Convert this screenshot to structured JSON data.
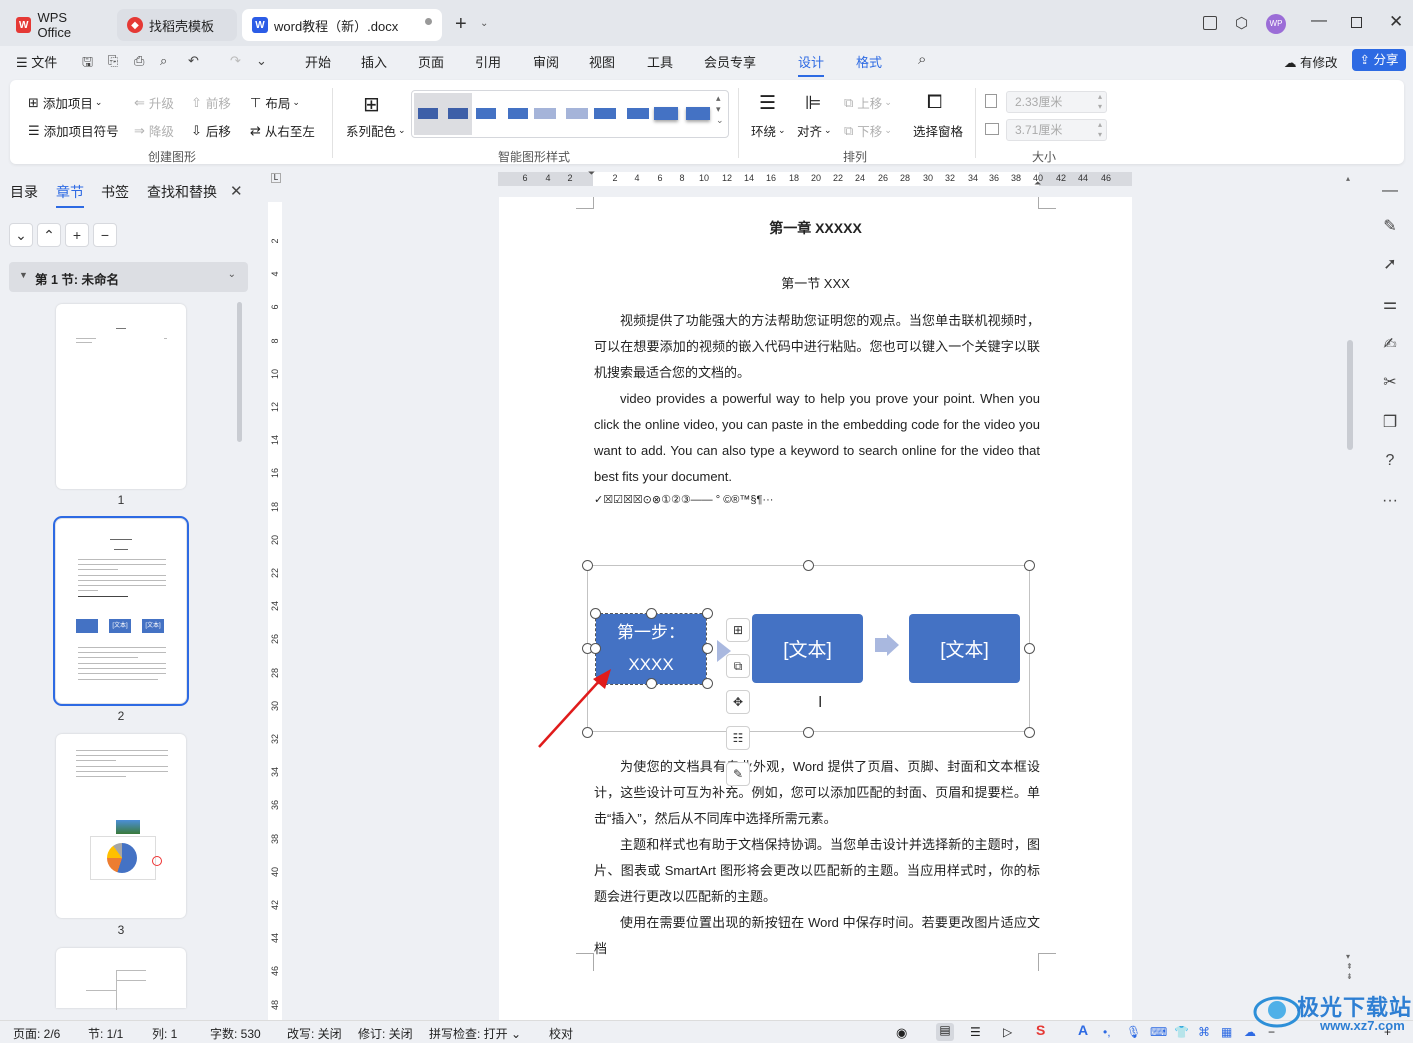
{
  "titlebar": {
    "tabs": [
      {
        "label": "WPS Office",
        "icon": "wps-logo-icon"
      },
      {
        "label": "找稻壳模板",
        "icon": "docer-icon"
      },
      {
        "label": "word教程（新）.docx",
        "icon": "word-doc-icon"
      }
    ],
    "add_tab": "+",
    "avatar": "WP",
    "colors": {
      "accent": "#2d6ae3",
      "wps_red": "#e53935",
      "doc_blue": "#2b5ce6"
    }
  },
  "menubar": {
    "file": "文件",
    "items": [
      "开始",
      "插入",
      "页面",
      "引用",
      "审阅",
      "视图",
      "工具",
      "会员专享",
      "设计",
      "格式"
    ],
    "active": "设计",
    "modified": "有修改",
    "share": "分享"
  },
  "ribbon": {
    "create": {
      "add_item": "添加项目",
      "add_bullet": "添加项目符号",
      "promote": "升级",
      "demote": "降级",
      "move_prev": "前移",
      "move_next": "后移",
      "layout": "布局",
      "rtl": "从右至左",
      "group_label": "创建图形"
    },
    "style": {
      "color": "系列配色",
      "group_label": "智能图形样式"
    },
    "arrange": {
      "wrap": "环绕",
      "align": "对齐",
      "up": "上移",
      "down": "下移",
      "pane": "选择窗格",
      "group_label": "排列"
    },
    "size": {
      "height": "2.33厘米",
      "width": "3.71厘米",
      "group_label": "大小"
    }
  },
  "nav": {
    "tabs": [
      "目录",
      "章节",
      "书签",
      "查找和替换"
    ],
    "active": "章节",
    "section": "第 1 节: 未命名",
    "pages": [
      "1",
      "2",
      "3"
    ]
  },
  "ruler": {
    "h_ticks": [
      "6",
      "4",
      "2",
      "2",
      "4",
      "6",
      "8",
      "10",
      "12",
      "14",
      "16",
      "18",
      "20",
      "22",
      "24",
      "26",
      "28",
      "30",
      "32",
      "34",
      "36",
      "38",
      "40",
      "42",
      "44",
      "46"
    ],
    "v_ticks": [
      "2",
      "4",
      "6",
      "8",
      "10",
      "12",
      "14",
      "16",
      "18",
      "20",
      "22",
      "24",
      "26",
      "28",
      "30",
      "32",
      "34",
      "36",
      "38",
      "40",
      "42",
      "44",
      "46",
      "48"
    ]
  },
  "document": {
    "chapter": "第一章  XXXXX",
    "section": "第一节  XXX",
    "para1": "视频提供了功能强大的方法帮助您证明您的观点。当您单击联机视频时，可以在想要添加的视频的嵌入代码中进行粘贴。您也可以键入一个关键字以联机搜索最适合您的文档的。",
    "para2": "video provides a powerful way to help you prove your point. When you click the online video, you can paste in the embedding code for the video you want to add. You can also type a keyword to search online for the video that best fits your document.",
    "symbols": "✓☒☑☒☒⊙⊗①②③——   °  ©®™§¶···",
    "smartart": [
      "第一步：\nXXXX",
      "[文本]",
      "[文本]"
    ],
    "para3": "为使您的文档具有专业外观，Word 提供了页眉、页脚、封面和文本框设计，这些设计可互为补充。例如，您可以添加匹配的封面、页眉和提要栏。单击“插入”，然后从不同库中选择所需元素。",
    "para4": "主题和样式也有助于文档保持协调。当您单击设计并选择新的主题时，图片、图表或 SmartArt 图形将会更改以匹配新的主题。当应用样式时，你的标题会进行更改以匹配新的主题。",
    "para5": "使用在需要位置出现的新按钮在 Word 中保存时间。若要更改图片适应文档"
  },
  "status": {
    "page": "页面: 2/6",
    "section": "节: 1/1",
    "column": "列: 1",
    "words": "字数: 530",
    "revise": "改写: 关闭",
    "track": "修订: 关闭",
    "spell": "拼写检查: 打开",
    "proof": "校对"
  },
  "watermark": {
    "cn": "极光下载站",
    "url": "www.xz7.com"
  }
}
